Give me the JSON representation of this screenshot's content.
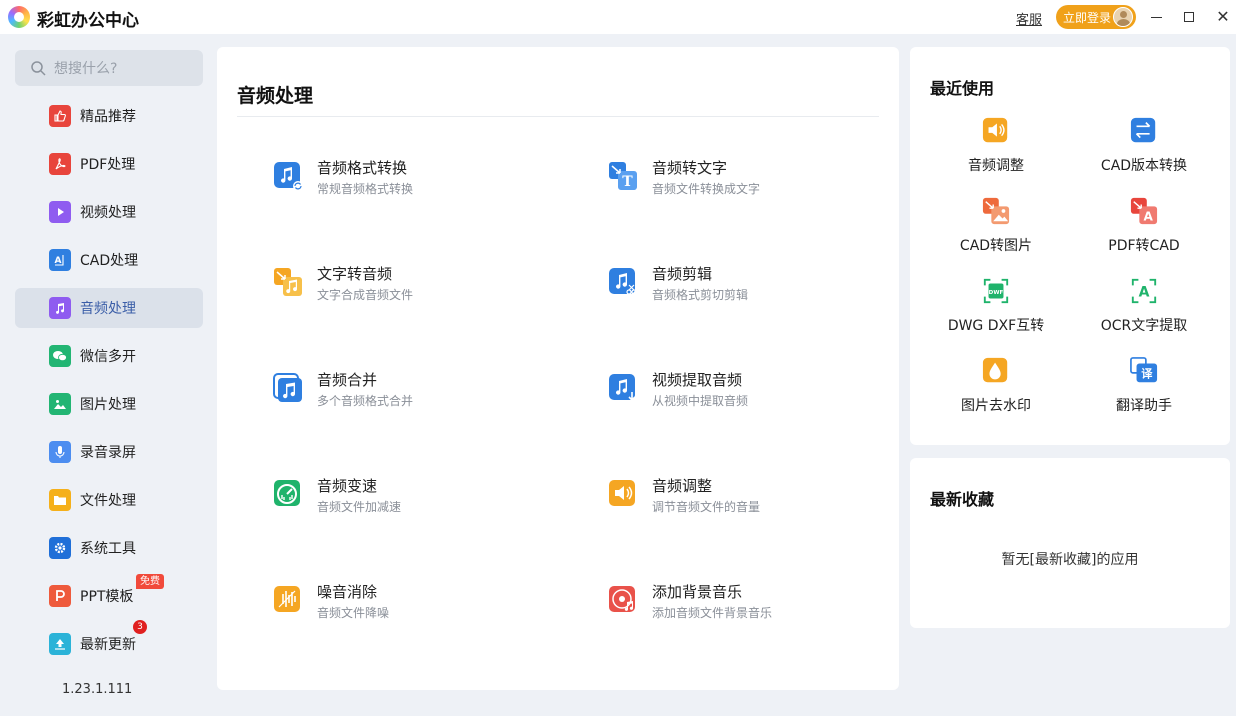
{
  "app": {
    "title": "彩虹办公中心"
  },
  "titlebar": {
    "service": "客服",
    "login": "立即登录"
  },
  "sidebar": {
    "search_placeholder": "想搜什么?",
    "items": [
      {
        "label": "精品推荐",
        "icon": "thumbs-up-icon",
        "color": "#e8453c"
      },
      {
        "label": "PDF处理",
        "icon": "pdf-icon",
        "color": "#e8453c"
      },
      {
        "label": "视频处理",
        "icon": "video-icon",
        "color": "#8f5cf0"
      },
      {
        "label": "CAD处理",
        "icon": "cad-icon",
        "color": "#2f7fe0"
      },
      {
        "label": "音频处理",
        "icon": "music-icon",
        "color": "#8f5cf0"
      },
      {
        "label": "微信多开",
        "icon": "wechat-icon",
        "color": "#22b573"
      },
      {
        "label": "图片处理",
        "icon": "image-icon",
        "color": "#22b573"
      },
      {
        "label": "录音录屏",
        "icon": "microphone-icon",
        "color": "#4c8df0"
      },
      {
        "label": "文件处理",
        "icon": "folder-icon",
        "color": "#f5b01a"
      },
      {
        "label": "系统工具",
        "icon": "gear-icon",
        "color": "#1f6fd8"
      },
      {
        "label": "PPT模板",
        "icon": "ppt-icon",
        "color": "#ee5a3c"
      },
      {
        "label": "最新更新",
        "icon": "upload-icon",
        "color": "#2bb3d8"
      }
    ],
    "free_tag": "免费",
    "update_badge": "3",
    "version": "1.23.1.111"
  },
  "main": {
    "title": "音频处理",
    "tools": [
      {
        "name": "音频格式转换",
        "desc": "常规音频格式转换",
        "icon": "audio-convert-icon",
        "color": "#2f7fe0"
      },
      {
        "name": "音频转文字",
        "desc": "音频文件转换成文字",
        "icon": "audio-to-text-icon",
        "color": "#2f7fe0"
      },
      {
        "name": "文字转音频",
        "desc": "文字合成音频文件",
        "icon": "text-to-audio-icon",
        "color": "#f5a623"
      },
      {
        "name": "音频剪辑",
        "desc": "音频格式剪切剪辑",
        "icon": "audio-cut-icon",
        "color": "#2f7fe0"
      },
      {
        "name": "音频合并",
        "desc": "多个音频格式合并",
        "icon": "audio-merge-icon",
        "color": "#2f7fe0"
      },
      {
        "name": "视频提取音频",
        "desc": "从视频中提取音频",
        "icon": "video-extract-audio-icon",
        "color": "#2f7fe0"
      },
      {
        "name": "音频变速",
        "desc": "音频文件加减速",
        "icon": "audio-speed-icon",
        "color": "#1fb36b"
      },
      {
        "name": "音频调整",
        "desc": "调节音频文件的音量",
        "icon": "volume-icon",
        "color": "#f5a623"
      },
      {
        "name": "噪音消除",
        "desc": "音频文件降噪",
        "icon": "noise-reduce-icon",
        "color": "#f5a623"
      },
      {
        "name": "添加背景音乐",
        "desc": "添加音频文件背景音乐",
        "icon": "background-music-icon",
        "color": "#e9524a"
      }
    ]
  },
  "recent": {
    "title": "最近使用",
    "items": [
      {
        "label": "音频调整",
        "icon": "volume-icon",
        "color": "#f5a623"
      },
      {
        "label": "CAD版本转换",
        "icon": "cad-version-icon",
        "color": "#2f7fe0"
      },
      {
        "label": "CAD转图片",
        "icon": "cad-to-image-icon",
        "color": "#ee6a3c"
      },
      {
        "label": "PDF转CAD",
        "icon": "pdf-to-cad-icon",
        "color": "#e8453c"
      },
      {
        "label": "DWG DXF互转",
        "icon": "dwg-dxf-icon",
        "color": "#1fb36b"
      },
      {
        "label": "OCR文字提取",
        "icon": "ocr-icon",
        "color": "#1fb36b"
      },
      {
        "label": "图片去水印",
        "icon": "watermark-icon",
        "color": "#f5a623"
      },
      {
        "label": "翻译助手",
        "icon": "translate-icon",
        "color": "#2f7fe0"
      }
    ]
  },
  "favorites": {
    "title": "最新收藏",
    "empty": "暂无[最新收藏]的应用"
  }
}
